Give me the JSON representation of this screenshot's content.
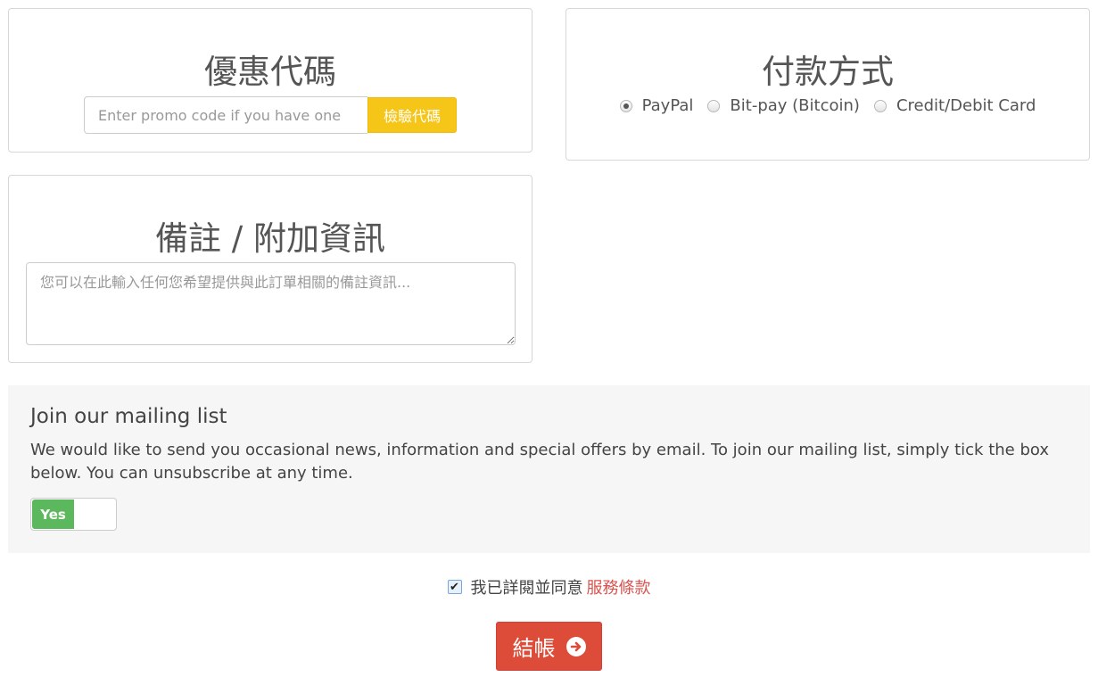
{
  "promo": {
    "title": "優惠代碼",
    "input_placeholder": "Enter promo code if you have one",
    "button_label": "檢驗代碼"
  },
  "payment": {
    "title": "付款方式",
    "options": [
      {
        "label": "PayPal",
        "checked": true
      },
      {
        "label": "Bit-pay (Bitcoin)",
        "checked": false
      },
      {
        "label": "Credit/Debit Card",
        "checked": false
      }
    ]
  },
  "notes": {
    "title": "備註 / 附加資訊",
    "placeholder": "您可以在此輸入任何您希望提供與此訂單相關的備註資訊..."
  },
  "mailing": {
    "title": "Join our mailing list",
    "description": "We would like to send you occasional news, information and special offers by email. To join our mailing list, simply tick the box below. You can unsubscribe at any time.",
    "toggle_label": "Yes",
    "toggle_on": true
  },
  "terms": {
    "checked": true,
    "text": "我已詳閱並同意",
    "link_text": "服務條款"
  },
  "checkout": {
    "label": "結帳",
    "icon": "arrow-circle-right-icon"
  },
  "colors": {
    "promo_button": "#f5c518",
    "toggle_on": "#5cb85c",
    "checkout": "#dd4b39",
    "link": "#d9534f"
  }
}
